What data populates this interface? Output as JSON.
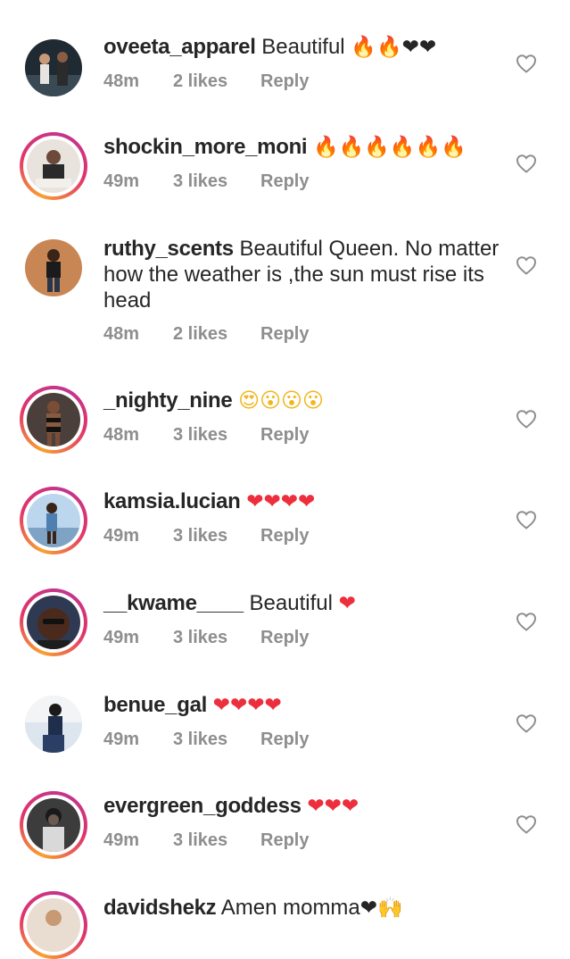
{
  "colors": {
    "text": "#262626",
    "meta": "#8e8e8e",
    "heart_emoji": "#ed2e3c",
    "story_ring_start": "#f9a131",
    "story_ring_end": "#c1358f"
  },
  "comments": [
    {
      "username": "oveeta_apparel",
      "text": "Beautiful",
      "emoji": "🔥🔥❤❤",
      "time": "48m",
      "likes": "2 likes",
      "reply": "Reply",
      "ring": false,
      "icon": "heart-outline-icon"
    },
    {
      "username": "shockin_more_moni",
      "text": "",
      "emoji": "🔥🔥🔥🔥🔥🔥",
      "time": "49m",
      "likes": "3 likes",
      "reply": "Reply",
      "ring": true,
      "icon": "heart-outline-icon"
    },
    {
      "username": "ruthy_scents",
      "text": "Beautiful Queen. No matter how the weather is ,the sun must rise its head",
      "emoji": "",
      "time": "48m",
      "likes": "2 likes",
      "reply": "Reply",
      "ring": false,
      "icon": "heart-outline-icon"
    },
    {
      "username": "_nighty_nine",
      "text": "",
      "emoji": "😍😮😮😮",
      "time": "48m",
      "likes": "3 likes",
      "reply": "Reply",
      "ring": true,
      "icon": "heart-outline-icon"
    },
    {
      "username": "kamsia.lucian",
      "text": "",
      "emoji": "❤❤❤❤",
      "time": "49m",
      "likes": "3 likes",
      "reply": "Reply",
      "ring": true,
      "icon": "heart-outline-icon"
    },
    {
      "username": "__kwame____",
      "text": "Beautiful",
      "emoji": "❤",
      "time": "49m",
      "likes": "3 likes",
      "reply": "Reply",
      "ring": true,
      "icon": "heart-outline-icon"
    },
    {
      "username": "benue_gal",
      "text": "",
      "emoji": "❤❤❤❤",
      "time": "49m",
      "likes": "3 likes",
      "reply": "Reply",
      "ring": false,
      "icon": "heart-outline-icon"
    },
    {
      "username": "evergreen_goddess",
      "text": "",
      "emoji": "❤❤❤",
      "time": "49m",
      "likes": "3 likes",
      "reply": "Reply",
      "ring": true,
      "icon": "heart-outline-icon"
    },
    {
      "username": "davidshekz",
      "text": "Amen momma",
      "emoji": "❤🙌",
      "time": "",
      "likes": "",
      "reply": "",
      "ring": true,
      "icon": "heart-outline-icon"
    }
  ]
}
